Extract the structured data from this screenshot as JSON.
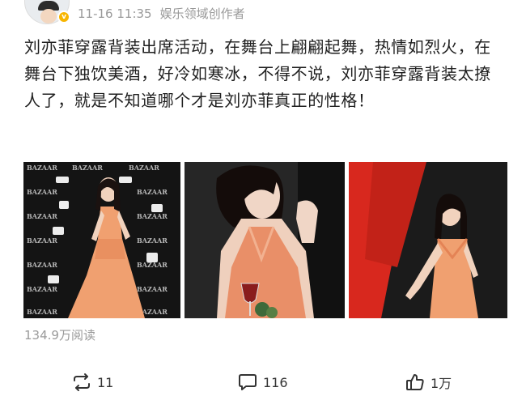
{
  "header": {
    "timestamp": "11-16 11:35",
    "source": "娱乐领域创作者",
    "verified_badge": "v"
  },
  "post": {
    "text": "刘亦菲穿露背装出席活动，在舞台上翩翩起舞，热情如烈火，在舞台下独饮美酒，好冷如寒冰，不得不说，刘亦菲穿露背装太撩人了，就是不知道哪个才是刘亦菲真正的性格！",
    "photo_backdrop_text": "BAZAAR"
  },
  "stats": {
    "reads": "134.9万阅读"
  },
  "actions": {
    "repost_count": "11",
    "comment_count": "116",
    "like_count": "1万"
  },
  "colors": {
    "accent_verify": "#f7b500",
    "dress": "#f0a070",
    "red_backdrop": "#d8281e",
    "meta_gray": "#999999"
  },
  "icons": {
    "repost": "repost-icon",
    "comment": "comment-icon",
    "like": "thumbs-up-icon"
  }
}
